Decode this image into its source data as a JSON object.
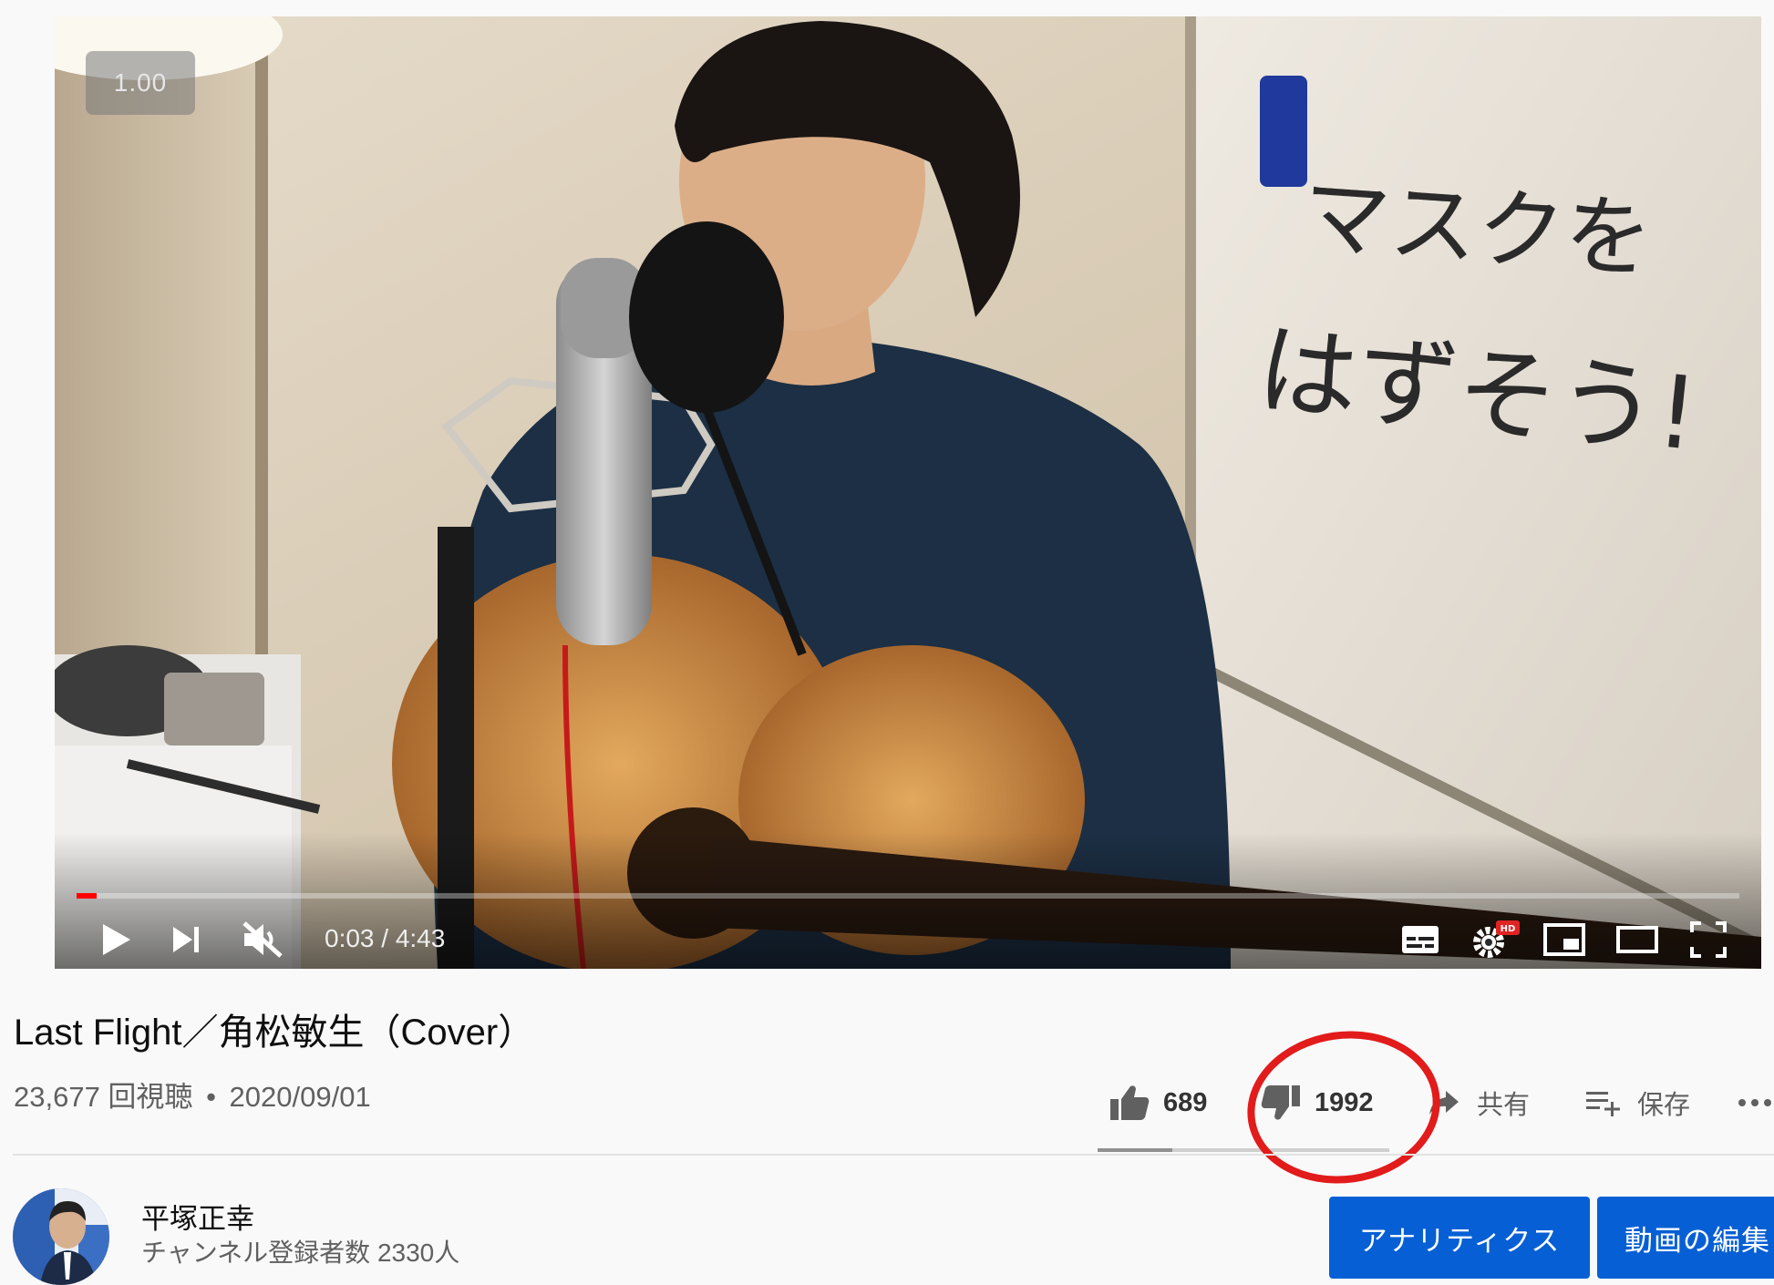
{
  "player": {
    "speed_badge": "1.00",
    "time": "0:03 / 4:43",
    "progress_fraction": 0.012,
    "whiteboard_text_line1": "マスクを",
    "whiteboard_text_line2": "はずそう!",
    "controls": [
      "play-icon",
      "next-icon",
      "mute-icon",
      "subtitles-icon",
      "settings-hd-icon",
      "miniplayer-icon",
      "theater-mode-icon",
      "fullscreen-icon"
    ],
    "colors": {
      "progress": "#ff0000"
    }
  },
  "video": {
    "title": "Last Flight／角松敏生（Cover）",
    "views": "23,677 回視聴",
    "separator": "•",
    "date": "2020/09/01"
  },
  "actions": {
    "likes": "689",
    "dislikes": "1992",
    "share": "共有",
    "save": "保存",
    "like_ratio": 0.257
  },
  "annotation": {
    "color": "#e21b1b",
    "target": "dislikes"
  },
  "channel": {
    "name": "平塚正幸",
    "subscribers": "チャンネル登録者数 2330人"
  },
  "buttons": {
    "analytics": "アナリティクス",
    "edit_video": "動画の編集"
  },
  "colors": {
    "button_blue": "#065fd4",
    "background": "#f9f9f9"
  }
}
